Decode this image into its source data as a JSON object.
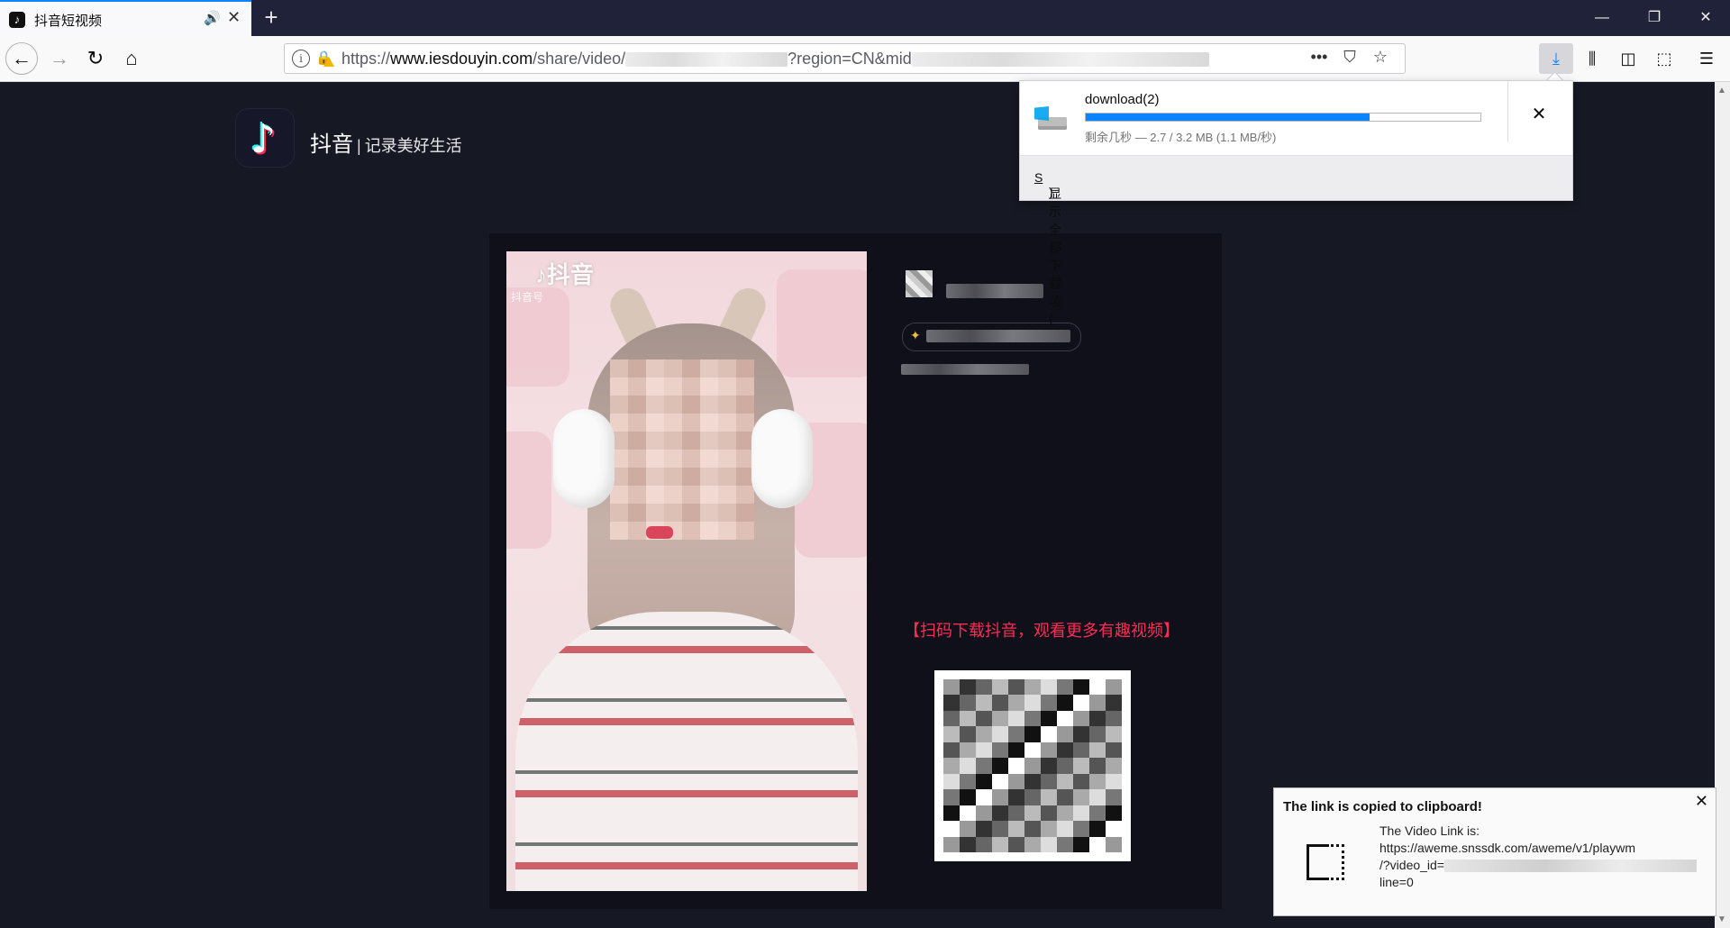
{
  "browser": {
    "tab": {
      "title": "抖音短视频",
      "favicon": "tiktok-note-icon",
      "audio_icon": "speaker-icon",
      "close_icon": "close-icon"
    },
    "new_tab_icon": "plus-icon",
    "window_controls": {
      "minimize": "minimize-icon",
      "restore": "restore-icon",
      "close": "close-icon"
    },
    "nav": {
      "back_icon": "arrow-left-icon",
      "forward_icon": "arrow-right-icon",
      "reload_icon": "reload-icon",
      "home_icon": "home-icon"
    },
    "url": {
      "prefix": "https://",
      "host": "www.iesdouyin.com",
      "path": "/share/video/",
      "query_visible": "?region=CN&mid"
    },
    "url_actions": {
      "more_icon": "ellipsis-icon",
      "pocket_icon": "pocket-icon",
      "bookmark_icon": "star-icon"
    },
    "toolbar_right": {
      "downloads_icon": "download-arrow-icon",
      "library_icon": "library-icon",
      "sidebar_icon": "sidebar-icon",
      "screenshot_icon": "screenshot-icon",
      "menu_icon": "hamburger-menu-icon"
    }
  },
  "page": {
    "brand_name": "抖音",
    "brand_separator": "|",
    "slogan": "记录美好生活",
    "video_watermark_logo": "♪抖音",
    "video_watermark_id": "抖音号",
    "promo_text": "【扫码下载抖音，观看更多有趣视频】",
    "colors": {
      "background": "#161823",
      "accent": "#fe2c55",
      "cyan": "#25f4ee"
    }
  },
  "downloads_panel": {
    "file_name": "download(2)",
    "progress_fraction": 0.72,
    "status": "剩余几秒 — 2.7 / 3.2 MB (1.1 MB/秒)",
    "cancel_icon": "close-icon",
    "show_all_label": "显示全部下载项(",
    "show_all_accesskey": "S",
    "show_all_close": ")"
  },
  "notification": {
    "title": "The link is copied to clipboard!",
    "line1": "The Video Link is:",
    "line2": "https://aweme.snssdk.com/aweme/v1/playwm",
    "line3": "/?video_id=",
    "line4": "line=0",
    "icon": "screenshot-selection-icon",
    "close_icon": "close-icon"
  }
}
